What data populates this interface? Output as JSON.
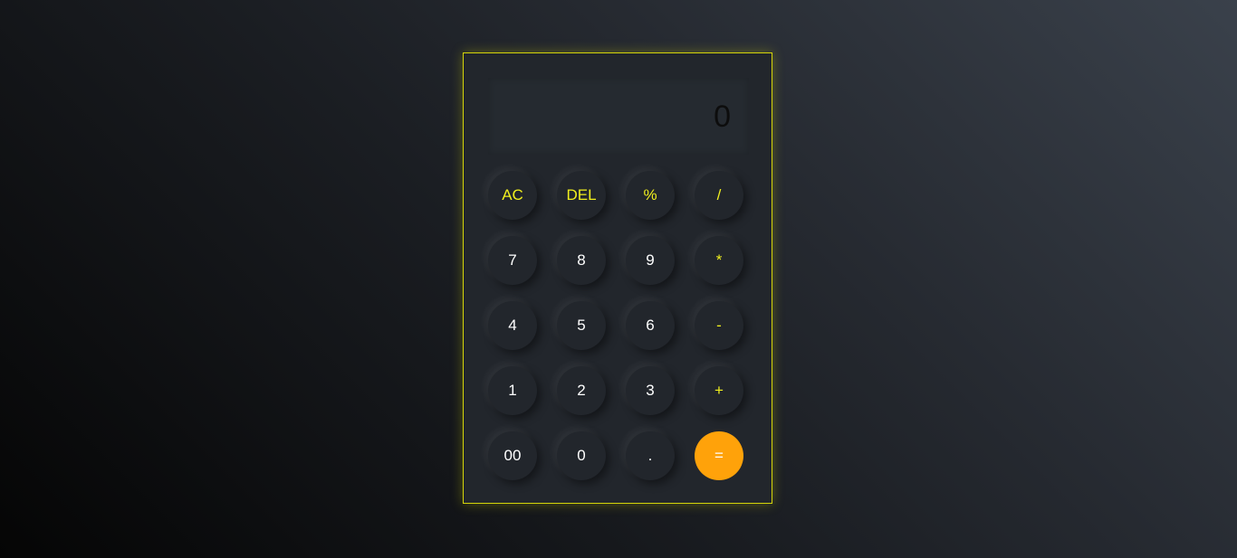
{
  "display": {
    "value": "0"
  },
  "rows": [
    [
      {
        "label": "AC",
        "name": "clear-button",
        "kind": "op"
      },
      {
        "label": "DEL",
        "name": "delete-button",
        "kind": "op"
      },
      {
        "label": "%",
        "name": "percent-button",
        "kind": "op"
      },
      {
        "label": "/",
        "name": "divide-button",
        "kind": "op"
      }
    ],
    [
      {
        "label": "7",
        "name": "digit-7-button",
        "kind": "num"
      },
      {
        "label": "8",
        "name": "digit-8-button",
        "kind": "num"
      },
      {
        "label": "9",
        "name": "digit-9-button",
        "kind": "num"
      },
      {
        "label": "*",
        "name": "multiply-button",
        "kind": "op"
      }
    ],
    [
      {
        "label": "4",
        "name": "digit-4-button",
        "kind": "num"
      },
      {
        "label": "5",
        "name": "digit-5-button",
        "kind": "num"
      },
      {
        "label": "6",
        "name": "digit-6-button",
        "kind": "num"
      },
      {
        "label": "-",
        "name": "subtract-button",
        "kind": "op"
      }
    ],
    [
      {
        "label": "1",
        "name": "digit-1-button",
        "kind": "num"
      },
      {
        "label": "2",
        "name": "digit-2-button",
        "kind": "num"
      },
      {
        "label": "3",
        "name": "digit-3-button",
        "kind": "num"
      },
      {
        "label": "+",
        "name": "add-button",
        "kind": "op"
      }
    ],
    [
      {
        "label": "00",
        "name": "double-zero-button",
        "kind": "num"
      },
      {
        "label": "0",
        "name": "digit-0-button",
        "kind": "num"
      },
      {
        "label": ".",
        "name": "decimal-button",
        "kind": "num"
      },
      {
        "label": "=",
        "name": "equals-button",
        "kind": "equals"
      }
    ]
  ],
  "colors": {
    "accent": "#f0ef1e",
    "equals": "#ffa20a",
    "body": "#22262c",
    "border": "#d4d40a"
  }
}
